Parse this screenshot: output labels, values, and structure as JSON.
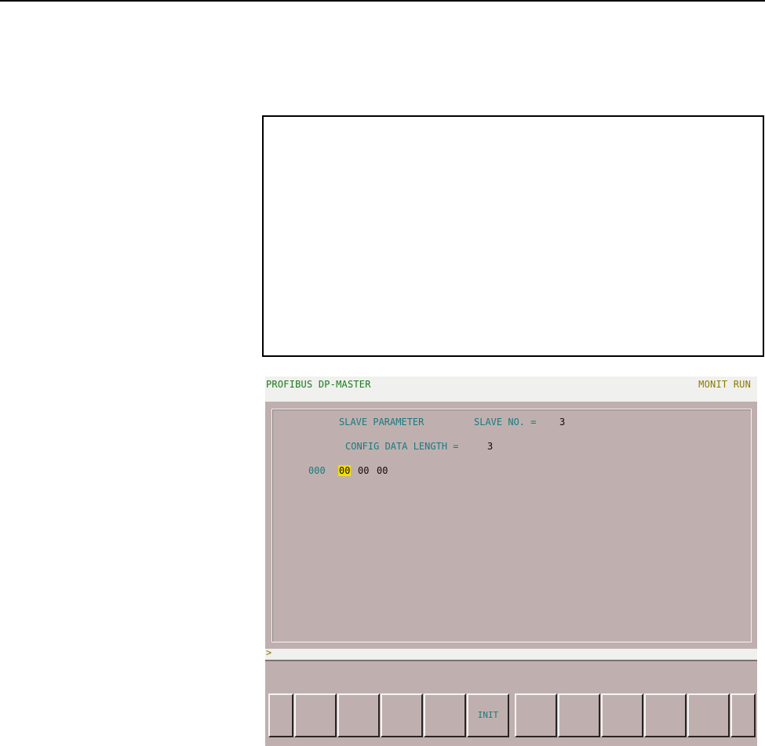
{
  "header": {
    "title": "PROFIBUS DP-MASTER",
    "mode": "MONIT RUN"
  },
  "slave_param": {
    "heading": "SLAVE PARAMETER",
    "slave_no_label": "SLAVE NO. =",
    "slave_no_value": "3",
    "config_label": "CONFIG DATA LENGTH =",
    "config_value": "3",
    "row_address": "000",
    "bytes": [
      "00",
      "00",
      "00"
    ]
  },
  "input_line": {
    "prompt": ">"
  },
  "softkeys": [
    "",
    "",
    "",
    "",
    "",
    "INIT",
    "",
    "",
    "",
    "",
    "",
    ""
  ],
  "colors": {
    "screen_bg": "#bfb0af",
    "title_green": "#1a7a1a",
    "status_yellow": "#8a7a00",
    "label_teal": "#1a7a80",
    "cursor_highlight": "#f0e000"
  }
}
